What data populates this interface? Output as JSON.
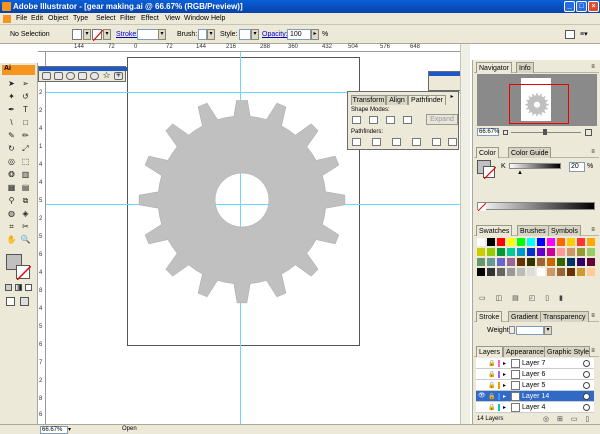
{
  "window": {
    "title": "Adobe Illustrator - [gear making.ai @ 66.67% (RGB/Preview)]"
  },
  "menubar": [
    "File",
    "Edit",
    "Object",
    "Type",
    "Select",
    "Filter",
    "Effect",
    "View",
    "Window",
    "Help"
  ],
  "control": {
    "selection": "No Selection",
    "stroke_label": "Stroke:",
    "brush_label": "Brush:",
    "style_label": "Style:",
    "opacity_label": "Opacity:",
    "opacity_value": "100",
    "percent": "%"
  },
  "ruler": {
    "h_ticks": [
      "144",
      "72",
      "0",
      "72",
      "144",
      "216",
      "288",
      "360",
      "432",
      "504",
      "576",
      "648"
    ],
    "v_ticks": [
      "5",
      "2",
      "2",
      "4",
      "1",
      "4",
      "4",
      "5",
      "2",
      "5",
      "6",
      "4",
      "8",
      "4",
      "5",
      "6",
      "7",
      "2",
      "8",
      "6"
    ]
  },
  "toolbox": {
    "header": "Ai"
  },
  "pathfinder": {
    "tabs": [
      "Transform",
      "Align",
      "Pathfinder"
    ],
    "shape_modes_label": "Shape Modes:",
    "pathfinders_label": "Pathfinders:",
    "expand_label": "Expand"
  },
  "navigator": {
    "tabs": [
      "Navigator",
      "Info"
    ],
    "zoom": "66.67%"
  },
  "color": {
    "tabs": [
      "Color",
      "Color Guide"
    ],
    "value": "20",
    "percent": "%",
    "gear_fill": "#c0c0c0"
  },
  "swatches": {
    "tabs": [
      "Swatches",
      "Brushes",
      "Symbols"
    ],
    "colors": [
      "#ffffff",
      "#000000",
      "#ff0000",
      "#ffff00",
      "#00ff00",
      "#00ffff",
      "#0000ff",
      "#ff00ff",
      "#ff6600",
      "#ffcc00",
      "#ff3333",
      "#ffaa00",
      "#cccc00",
      "#99cc00",
      "#009933",
      "#00cc99",
      "#0099cc",
      "#0033cc",
      "#6600cc",
      "#cc0099",
      "#ff9999",
      "#cc9966",
      "#999933",
      "#99cc66",
      "#669966",
      "#669999",
      "#6666cc",
      "#996699",
      "#663300",
      "#333300",
      "#996633",
      "#cc6600",
      "#336600",
      "#003366",
      "#330066",
      "#660033",
      "#000000",
      "#333333",
      "#666666",
      "#999999",
      "#bbbbbb",
      "#dddddd",
      "#ffffff",
      "#cc9966",
      "#996633",
      "#663300",
      "#cc9933",
      "#ffcc99"
    ]
  },
  "stroke_panel": {
    "tabs": [
      "Stroke",
      "Gradient",
      "Transparency"
    ],
    "weight_label": "Weight:"
  },
  "layers_panel": {
    "tabs": [
      "Layers",
      "Appearance",
      "Graphic Styles"
    ],
    "rows": [
      {
        "name": "Layer 7",
        "color": "#ff66cc",
        "selected": false
      },
      {
        "name": "Layer 6",
        "color": "#a060ff",
        "selected": false
      },
      {
        "name": "Layer 5",
        "color": "#ff9900",
        "selected": false
      },
      {
        "name": "Layer 14",
        "color": "#3399ff",
        "selected": true
      },
      {
        "name": "Layer 4",
        "color": "#00cccc",
        "selected": false
      }
    ],
    "count": "14 Layers"
  },
  "status": {
    "zoom": "66.67%",
    "state": "Open"
  }
}
